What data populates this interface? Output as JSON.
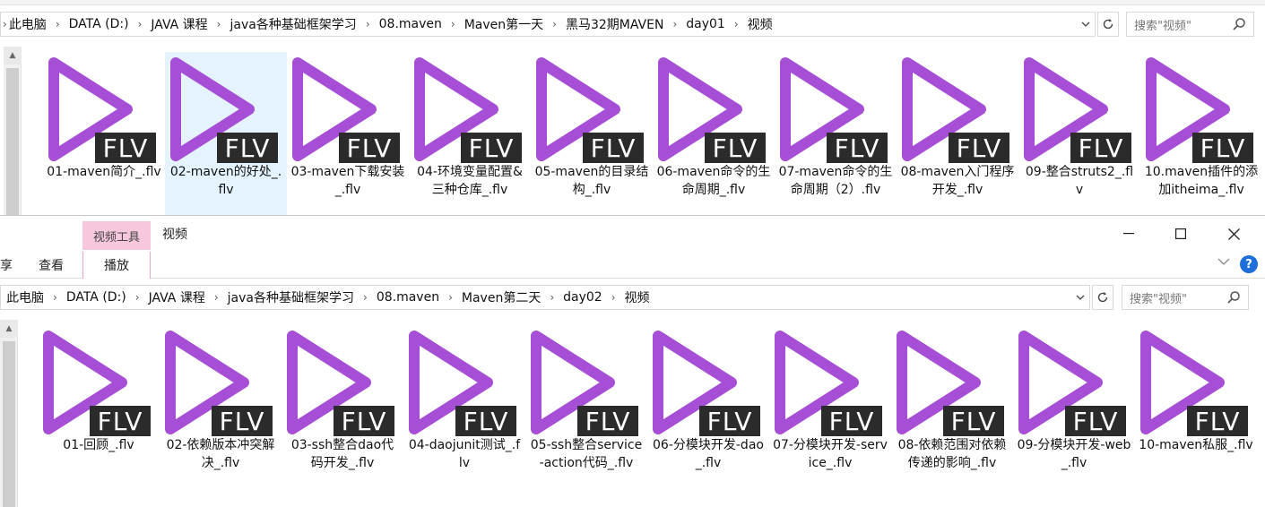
{
  "window1": {
    "breadcrumb": [
      "此电脑",
      "DATA (D:)",
      "JAVA 课程",
      "java各种基础框架学习",
      "08.maven",
      "Maven第一天",
      "黑马32期MAVEN",
      "day01",
      "视频"
    ],
    "search_placeholder": "搜索\"视频\"",
    "files": [
      {
        "name": "01-maven简介_.flv"
      },
      {
        "name": "02-maven的好处_.flv",
        "selected": true
      },
      {
        "name": "03-maven下载安装_.flv"
      },
      {
        "name": "04-环境变量配置&三种仓库_.flv"
      },
      {
        "name": "05-maven的目录结构_.flv"
      },
      {
        "name": "06-maven命令的生命周期_.flv"
      },
      {
        "name": "07-maven命令的生命周期（2）.flv"
      },
      {
        "name": "08-maven入门程序开发_.flv"
      },
      {
        "name": "09-整合struts2_.flv"
      },
      {
        "name": "10.maven插件的添加itheima_.flv"
      }
    ]
  },
  "window2": {
    "ribbon": {
      "context_tab": "视频工具",
      "title": "视频",
      "tab_share": "享",
      "tab_view": "查看",
      "tab_play": "播放",
      "help": "?"
    },
    "breadcrumb": [
      "此电脑",
      "DATA (D:)",
      "JAVA 课程",
      "java各种基础框架学习",
      "08.maven",
      "Maven第二天",
      "day02",
      "视频"
    ],
    "search_placeholder": "搜索\"视频\"",
    "files": [
      {
        "name": "01-回顾_.flv"
      },
      {
        "name": "02-依赖版本冲突解决_.flv"
      },
      {
        "name": "03-ssh整合dao代码开发_.flv"
      },
      {
        "name": "04-daojunit测试_.flv"
      },
      {
        "name": "05-ssh整合service-action代码_.flv"
      },
      {
        "name": "06-分模块开发-dao_.flv"
      },
      {
        "name": "07-分模块开发-service_.flv"
      },
      {
        "name": "08-依赖范围对依赖传递的影响_.flv"
      },
      {
        "name": "09-分模块开发-web_.flv"
      },
      {
        "name": "10-maven私服_.flv"
      }
    ]
  },
  "icon": {
    "badge_text": "FLV",
    "play_color": "#a64fd6",
    "badge_color": "#2b2b2b"
  },
  "colors": {
    "selection": "#e5f3ff",
    "context_tab": "#f7c7dd",
    "help": "#1e6fd9"
  }
}
